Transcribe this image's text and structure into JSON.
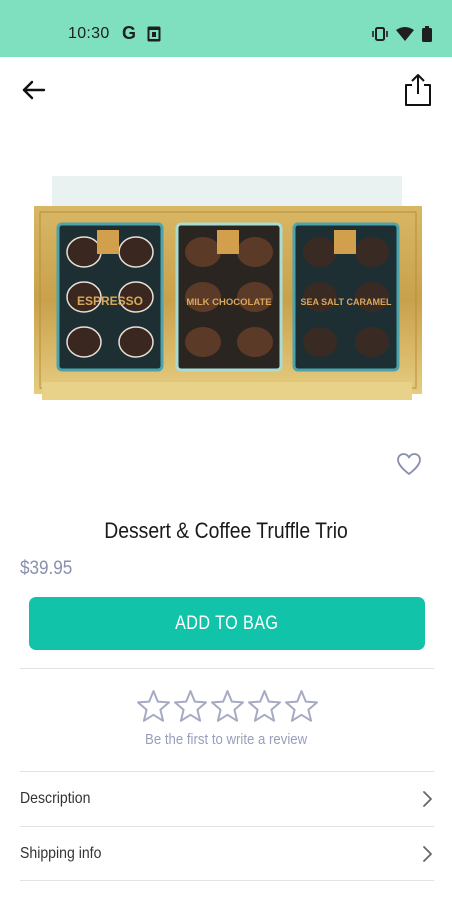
{
  "status_bar": {
    "time": "10:30",
    "g_label": "G"
  },
  "header": {
    "back_icon": "arrow-left",
    "share_icon": "share"
  },
  "product": {
    "image_alt": "Dessert & Coffee Truffle Trio box",
    "title": "Dessert & Coffee Truffle Trio",
    "price": "$39.95",
    "box_labels": [
      "ESPRESSO",
      "MILK CHOCOLATE",
      "SEA SALT CARAMEL"
    ]
  },
  "actions": {
    "add_to_bag": "ADD TO BAG"
  },
  "reviews": {
    "rating": 0,
    "max_rating": 5,
    "prompt": "Be the first to write a review"
  },
  "details": {
    "items": [
      {
        "label": "Description"
      },
      {
        "label": "Shipping info"
      }
    ]
  },
  "colors": {
    "status_bar": "#7fe0bf",
    "accent": "#10c3a9",
    "price": "#8a8fae",
    "stars": "#a6aac3"
  }
}
